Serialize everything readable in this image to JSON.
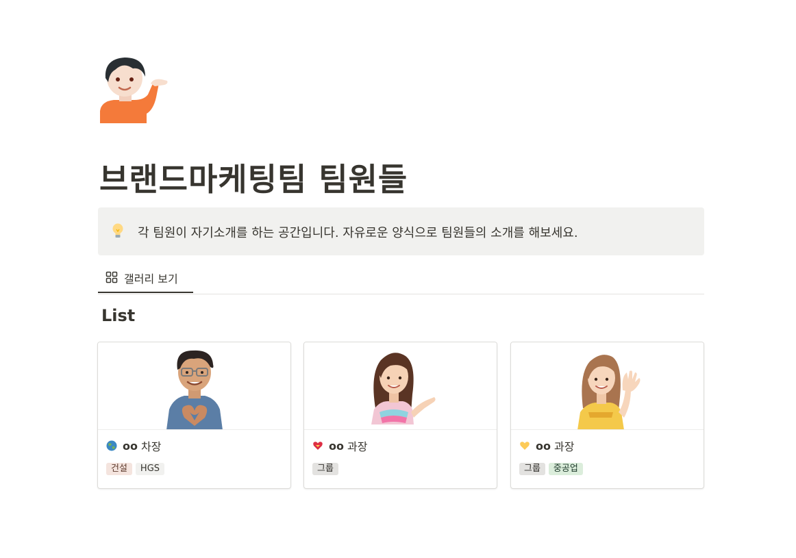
{
  "page": {
    "title": "브랜드마케팅팀 팀원들",
    "icon": "person-tipping-hand-icon"
  },
  "callout": {
    "icon": "lightbulb-icon",
    "text": "각 팀원이 자기소개를 하는 공간입니다. 자유로운 양식으로 팀원들의 소개를 해보세요."
  },
  "view_tabs": [
    {
      "label": "갤러리 보기",
      "icon": "gallery-grid-icon",
      "active": true
    }
  ],
  "section_title": "List",
  "cards": [
    {
      "cover": "memoji-man-heart-hands",
      "emoji": "globe-icon",
      "name_bold": "oo",
      "name_rest": "차장",
      "tags": [
        {
          "label": "건설",
          "bg": "#f4e4de",
          "fg": "#5d3b2e"
        },
        {
          "label": "HGS",
          "bg": "#f1f1ef",
          "fg": "#37352f"
        }
      ]
    },
    {
      "cover": "memoji-woman-presenting",
      "emoji": "heart-with-ribbon-icon",
      "name_bold": "oo",
      "name_rest": "과장",
      "tags": [
        {
          "label": "그룹",
          "bg": "#e3e2e0",
          "fg": "#32302c"
        }
      ]
    },
    {
      "cover": "memoji-woman-waving",
      "emoji": "yellow-heart-icon",
      "name_bold": "oo",
      "name_rest": "과장",
      "tags": [
        {
          "label": "그룹",
          "bg": "#e3e2e0",
          "fg": "#32302c"
        },
        {
          "label": "중공업",
          "bg": "#dbeddb",
          "fg": "#1c3829"
        }
      ]
    }
  ]
}
